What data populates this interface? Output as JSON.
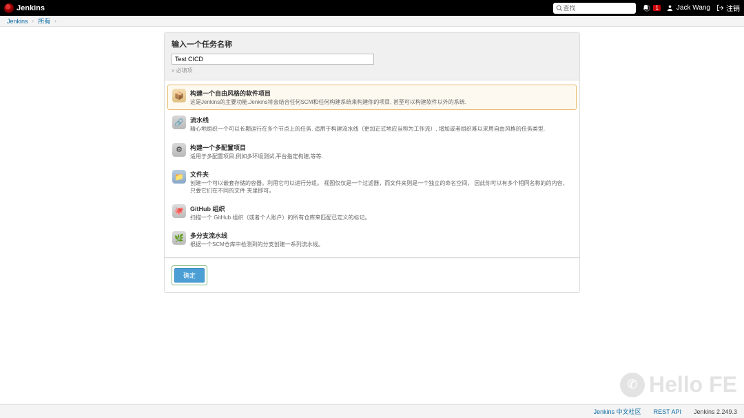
{
  "header": {
    "logo_text": "Jenkins",
    "search_placeholder": "查找",
    "notification_count": "1",
    "username": "Jack Wang",
    "logout_label": "注销"
  },
  "breadcrumb": {
    "items": [
      "Jenkins",
      "所有"
    ]
  },
  "panel": {
    "title": "输入一个任务名称",
    "name_value": "Test CICD",
    "required_text": "» 必填项"
  },
  "types": [
    {
      "id": "freestyle",
      "title": "构建一个自由风格的软件项目",
      "desc": "这是Jenkins的主要功能.Jenkins将会结合任何SCM和任何构建系统来构建你的项目, 甚至可以构建软件以外的系统.",
      "icon": "ic-freestyle",
      "selected": true
    },
    {
      "id": "pipeline",
      "title": "流水线",
      "desc": "精心地组织一个可以长期运行在多个节点上的任务. 适用于构建流水线（更加正式地应当称为工作流）, 增加或者组织难以采用自由风格的任务类型.",
      "icon": "ic-pipeline",
      "selected": false
    },
    {
      "id": "multiconfig",
      "title": "构建一个多配置项目",
      "desc": "适用于多配置项目,例如多环境测试,平台指定构建,等等.",
      "icon": "ic-multi",
      "selected": false
    },
    {
      "id": "folder",
      "title": "文件夹",
      "desc": "创建一个可以嵌套存储的容器。利用它可以进行分组。 视图仅仅是一个过滤器，而文件夹则是一个独立的命名空间， 因此你可以有多个相同名称的的内容，只要它们在不同的文件 夹里即可。",
      "icon": "ic-folder",
      "selected": false
    },
    {
      "id": "github-org",
      "title": "GitHub 组织",
      "desc": "扫描一个 GitHub 组织（或者个人账户）的所有仓库来匹配已定义的标记。",
      "icon": "ic-github",
      "selected": false
    },
    {
      "id": "multibranch",
      "title": "多分支流水线",
      "desc": "根据一个SCM仓库中检测到的分支创建一系列流水线。",
      "icon": "ic-multibranch",
      "selected": false
    }
  ],
  "ok_label": "确定",
  "watermark": "Hello FE",
  "footer": {
    "community": "Jenkins 中文社区",
    "rest": "REST API",
    "version": "Jenkins 2.249.3"
  }
}
